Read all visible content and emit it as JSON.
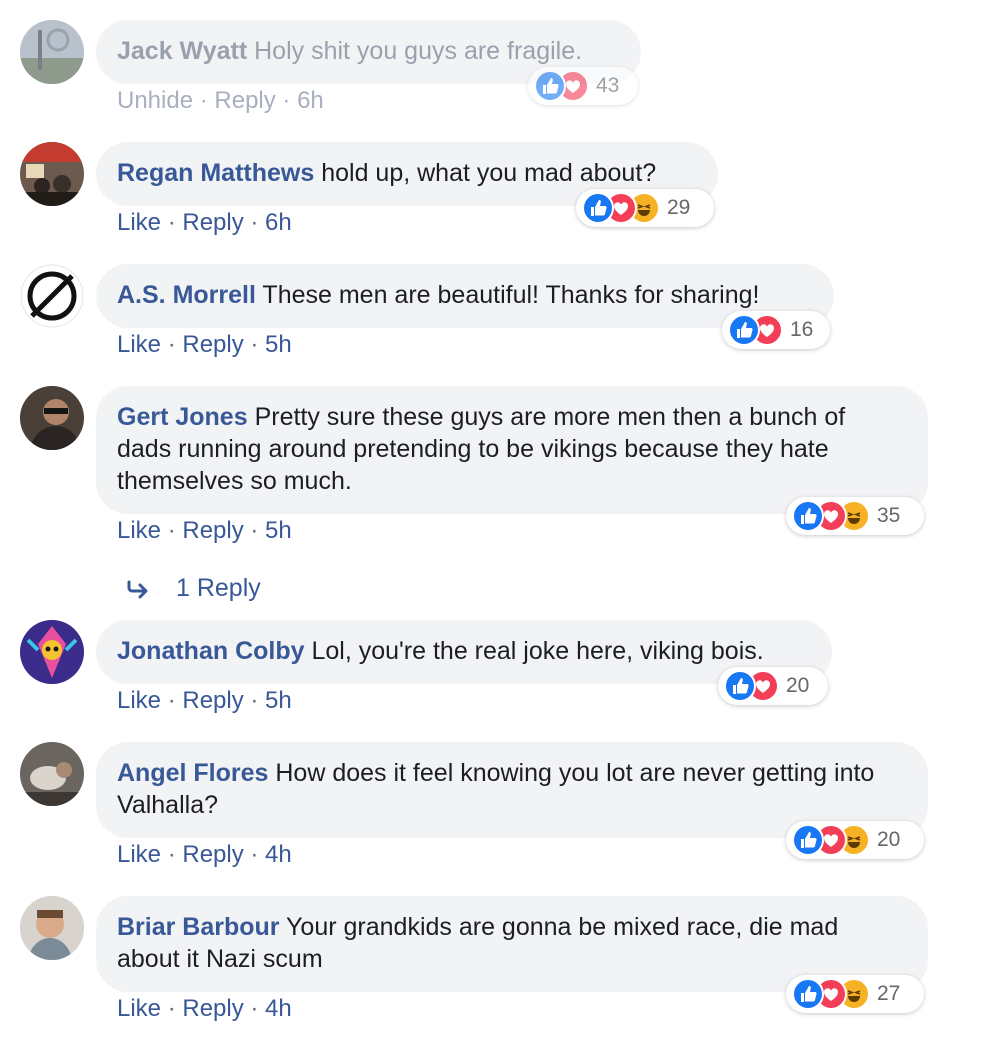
{
  "comments": [
    {
      "author": "Jack Wyatt",
      "text": "Holy shit you guys are fragile.",
      "actions": [
        "Unhide",
        "Reply",
        "6h"
      ],
      "reactions": [
        "like-icon",
        "love-icon"
      ],
      "reaction_count": "43"
    },
    {
      "author": "Regan Matthews",
      "text": "hold up, what you mad about?",
      "actions": [
        "Like",
        "Reply",
        "6h"
      ],
      "reactions": [
        "like-icon",
        "love-icon",
        "haha-icon"
      ],
      "reaction_count": "29"
    },
    {
      "author": "A.S. Morrell",
      "text": "These men are beautiful! Thanks for sharing!",
      "actions": [
        "Like",
        "Reply",
        "5h"
      ],
      "reactions": [
        "like-icon",
        "love-icon"
      ],
      "reaction_count": "16"
    },
    {
      "author": "Gert Jones",
      "text": "Pretty sure these guys are more men then a bunch of dads running around pretending to be vikings because they hate themselves so much.",
      "actions": [
        "Like",
        "Reply",
        "5h"
      ],
      "reactions": [
        "like-icon",
        "love-icon",
        "haha-icon"
      ],
      "reaction_count": "35"
    },
    {
      "author": "Jonathan Colby",
      "text": "Lol, you're the real joke here, viking bois.",
      "actions": [
        "Like",
        "Reply",
        "5h"
      ],
      "reactions": [
        "like-icon",
        "love-icon"
      ],
      "reaction_count": "20"
    },
    {
      "author": "Angel Flores",
      "text": "How does it feel knowing you lot are never getting into Valhalla?",
      "actions": [
        "Like",
        "Reply",
        "4h"
      ],
      "reactions": [
        "like-icon",
        "love-icon",
        "haha-icon"
      ],
      "reaction_count": "20"
    },
    {
      "author": "Briar Barbour",
      "text": "Your grandkids are gonna be mixed race, die mad about it Nazi scum",
      "actions": [
        "Like",
        "Reply",
        "4h"
      ],
      "reactions": [
        "like-icon",
        "love-icon",
        "haha-icon"
      ],
      "reaction_count": "27"
    }
  ],
  "replies_link": {
    "label": "1 Reply",
    "icon": "reply-arrow-icon"
  },
  "colors": {
    "link": "#385898",
    "bubble": "#f2f3f5",
    "like": "#1877f2",
    "love": "#f33e58",
    "haha": "#f7b125"
  }
}
